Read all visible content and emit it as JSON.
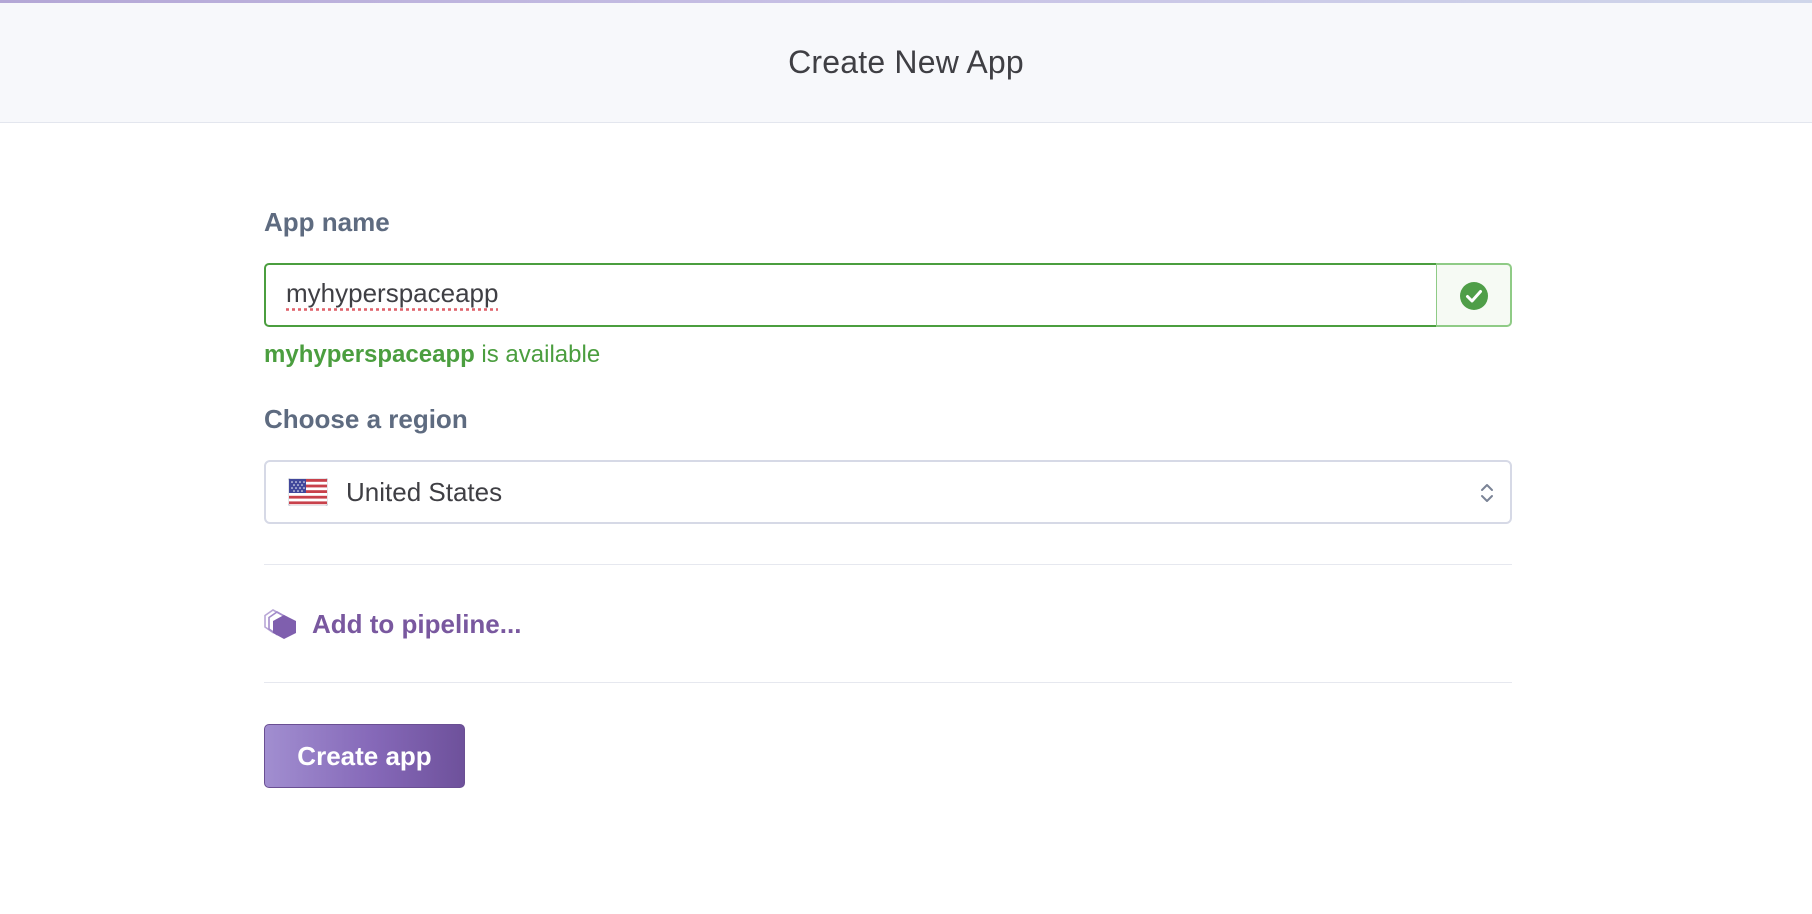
{
  "header": {
    "title": "Create New App"
  },
  "app_name": {
    "label": "App name",
    "value": "myhyperspaceapp",
    "status_icon": "check-circle-icon",
    "availability_name": "myhyperspaceapp",
    "availability_suffix": " is available"
  },
  "region": {
    "label": "Choose a region",
    "selected": "United States",
    "flag_icon": "us-flag-icon",
    "chevron_icon": "up-down-chevron-icon"
  },
  "pipeline": {
    "label": "Add to pipeline...",
    "icon": "pipeline-icon"
  },
  "actions": {
    "create_label": "Create app"
  },
  "colors": {
    "success": "#4b9e3f",
    "brand_purple": "#79589f",
    "label_gray": "#5e6b80"
  }
}
